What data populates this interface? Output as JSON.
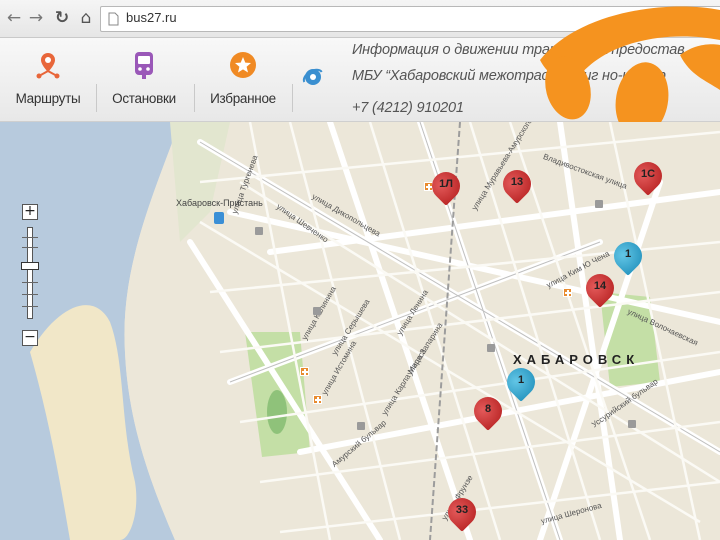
{
  "browser": {
    "back_glyph": "←",
    "forward_glyph": "→",
    "reload_glyph": "↻",
    "home_glyph": "⌂",
    "url": "bus27.ru"
  },
  "toolbar": {
    "items": [
      {
        "label": "Маршруты",
        "icon": "route-pin-icon",
        "color": "#e8663a"
      },
      {
        "label": "Остановки",
        "icon": "bus-stop-icon",
        "color": "#9a58b8"
      },
      {
        "label": "Избранное",
        "icon": "star-icon",
        "color": "#f08a24"
      }
    ],
    "info_lines": [
      "Информация о движении транспорта предостав",
      "МБУ “Хабаровский межотрасл     навиг     но-инфор",
      "+7 (4212) 910201"
    ],
    "logo_color": "#f5931f"
  },
  "map": {
    "city_label": "ХАБАРОВСК",
    "pier_label": "Хабаровск-Пристань",
    "streets": [
      {
        "name": "улица Серышева"
      },
      {
        "name": "улица Карла Маркса"
      },
      {
        "name": "улица Ленина"
      },
      {
        "name": "улица Запарина"
      },
      {
        "name": "Амурский бульвар"
      },
      {
        "name": "улица Истомина"
      },
      {
        "name": "улица Калинина"
      },
      {
        "name": "улица Фрунзе"
      },
      {
        "name": "Уссурийский бульвар"
      },
      {
        "name": "улица Муравьева-Амурского"
      },
      {
        "name": "улица Шеронова"
      },
      {
        "name": "Владивостокская улица"
      },
      {
        "name": "улица Волочаевская"
      },
      {
        "name": "улица Тургенева"
      },
      {
        "name": "улица Шевченко"
      },
      {
        "name": "улица Дикопольцева"
      },
      {
        "name": "улица Ким Ю Чена"
      }
    ],
    "markers": [
      {
        "label": "1Л",
        "type": "red"
      },
      {
        "label": "13",
        "type": "red"
      },
      {
        "label": "1С",
        "type": "red"
      },
      {
        "label": "1",
        "type": "blue"
      },
      {
        "label": "14",
        "type": "red"
      },
      {
        "label": "1",
        "type": "blue"
      },
      {
        "label": "8",
        "type": "red"
      },
      {
        "label": "33",
        "type": "red"
      }
    ],
    "zoom": {
      "plus": "+",
      "minus": "−"
    },
    "colors": {
      "water": "#b7cadd",
      "sand": "#f1e7c8",
      "park": "#c4dfa6",
      "road": "#ffffff",
      "land": "#ece7d9"
    }
  }
}
